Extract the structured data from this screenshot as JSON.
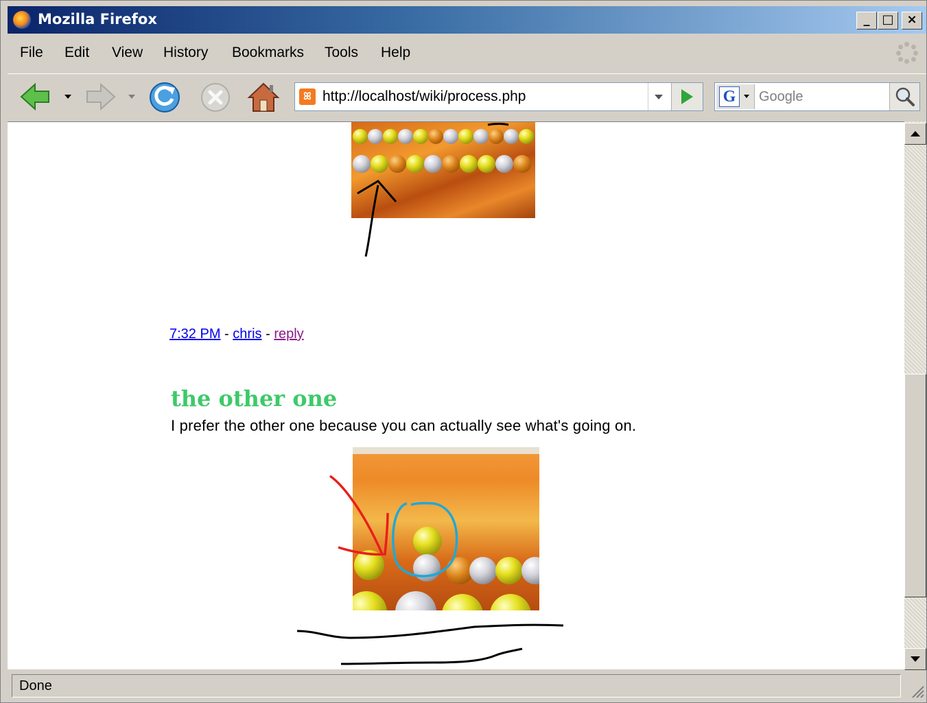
{
  "window": {
    "title": "Mozilla Firefox",
    "controls": {
      "minimize": "_",
      "maximize": "□",
      "close": "×"
    }
  },
  "menu": [
    "File",
    "Edit",
    "View",
    "History",
    "Bookmarks",
    "Tools",
    "Help"
  ],
  "toolbar": {
    "url": "http://localhost/wiki/process.php",
    "url_icon": "xampp-site-icon",
    "search_placeholder": "Google",
    "search_engine": "G"
  },
  "content": {
    "comment_meta": {
      "time": "7:32 PM",
      "author": "chris",
      "reply": "reply",
      "separator": "-"
    },
    "post": {
      "title": "the other one",
      "body": "I prefer the other one because you can actually see what's going on."
    }
  },
  "status": {
    "text": "Done"
  },
  "colors": {
    "title_green": "#3ec96a",
    "link_blue": "#0000ee",
    "link_visited": "#8b1a8b",
    "annotation_red": "#e8201a",
    "annotation_blue": "#1fa8d8"
  }
}
